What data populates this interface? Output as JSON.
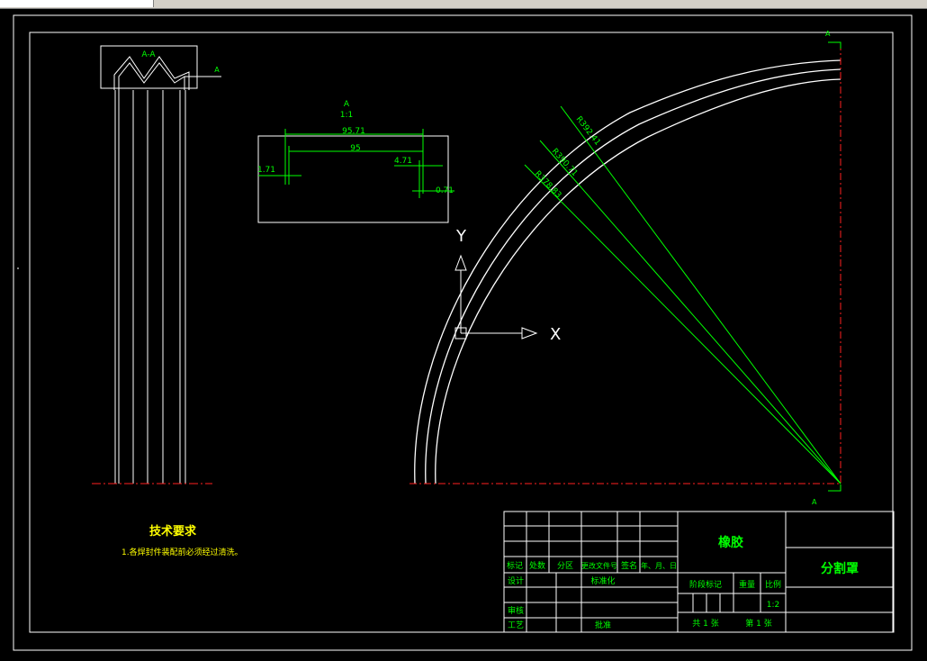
{
  "window": {
    "menu_fragment": ""
  },
  "section_view": {
    "label": "A-A",
    "marker": "A"
  },
  "detail": {
    "label": "A",
    "scale": "1:1",
    "dims": [
      "95.71",
      "95",
      "1.71",
      "4.71",
      "0.71"
    ]
  },
  "arc": {
    "radii": [
      "R392.41",
      "R390.71",
      "R378.83"
    ],
    "axis_y": "Y",
    "axis_x": "X",
    "section_top": "A",
    "section_bottom": "A"
  },
  "tech_req": {
    "title": "技术要求",
    "item1": "1.各焊封件装配前必须经过清洗。"
  },
  "title_block": {
    "material": "橡胶",
    "part_name": "分割罩",
    "rev_headers": [
      "标记",
      "处数",
      "分区",
      "更改文件号",
      "签名",
      "年、月、日"
    ],
    "design": "设计",
    "standard": "标准化",
    "review": "审核",
    "process": "工艺",
    "approve": "批准",
    "stage_mark": "阶段标记",
    "weight": "重量",
    "scale_label": "比例",
    "scale_value": "1:2",
    "sheets_total": "共 1 张",
    "sheet_no": "第 1 张"
  },
  "colors": {
    "background": "#000000",
    "lines": "#ffffff",
    "dims": "#00ff00",
    "center": "#ff2020",
    "highlight": "#ffff00"
  }
}
